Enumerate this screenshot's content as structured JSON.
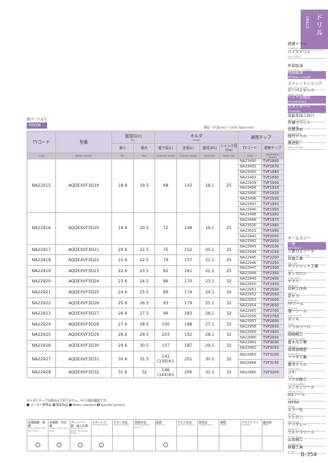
{
  "sidebar": {
    "tab_title": "ドリル",
    "tab_subtitle": "DRILLS",
    "items": [
      {
        "jp": "超硬ドリル",
        "en": "CARBIDE DRILLS",
        "hl": false
      },
      {
        "jp": "ハイスドリル",
        "en": "HSS DRILLS",
        "hl": false
      },
      {
        "jp": "外部給油",
        "en": "EXTERNAL COOLANT",
        "hl": false
      },
      {
        "jp": "内部給油",
        "en": "INTERNAL COOLANT",
        "hl": true
      },
      {
        "jp": "ストレートシャンク",
        "en": "STRAIGHT SHANK",
        "hl": false
      },
      {
        "jp": "テーパシャンク",
        "en": "TAPER SHANK",
        "hl": false
      },
      {
        "jp": "ヘッド交換式",
        "en": "EXCHANGEABLE",
        "hl": true
      },
      {
        "jp": "スタンダード",
        "en": "STANDARD",
        "hl": true
      },
      {
        "jp": "高能率加工向け",
        "en": "HIGH EFFICIENCY",
        "hl": false
      },
      {
        "jp": "先端フラット",
        "en": "FLAT END",
        "hl": false
      },
      {
        "jp": "位置決め",
        "en": "CENTERING",
        "hl": false
      },
      {
        "jp": "段付ドリル",
        "en": "STEP DRILLS",
        "hl": false
      },
      {
        "jp": "周途別",
        "en": "APPLICATION",
        "hl": false
      },
      {
        "jp": "オーエスジー",
        "en": "OSG",
        "hl": false
      },
      {
        "jp": "三菱",
        "en": "MITSUBISHI",
        "hl": true
      },
      {
        "jp": "三菱日立ツール",
        "en": "MMC HITACHI TOOL",
        "hl": false
      },
      {
        "jp": "日進工具",
        "en": "NS TOOL",
        "hl": false
      },
      {
        "jp": "ダイジェット工業",
        "en": "DIJET",
        "hl": false
      },
      {
        "jp": "タンガロイ",
        "en": "TUNGALOY",
        "hl": false
      },
      {
        "jp": "ヤマト",
        "en": "YAMATO",
        "hl": false
      },
      {
        "jp": "日研工作所",
        "en": "NIKKEN",
        "hl": false
      },
      {
        "jp": "京セラ",
        "en": "KYOCERA",
        "hl": false
      },
      {
        "jp": "FPツール",
        "en": "FP TOOL",
        "hl": false
      },
      {
        "jp": "彌一ツール",
        "en": "YAICHI TOOL",
        "hl": false
      },
      {
        "jp": "ダイキ",
        "en": "DAIKI",
        "hl": false
      },
      {
        "jp": "イワタツール",
        "en": "IWATA TOOL",
        "hl": false
      },
      {
        "jp": "岡崎精工",
        "en": "OKAZAKI SEIKO",
        "hl": false
      },
      {
        "jp": "富士元工業",
        "en": "FUJIGEN",
        "hl": false
      },
      {
        "jp": "高周波精密",
        "en": "KOSHUHA",
        "hl": false
      },
      {
        "jp": "イワタ工業",
        "en": "IWATA KOGYO",
        "hl": false
      },
      {
        "jp": "東洋ドリル",
        "en": "TOYO DRILL",
        "hl": false
      },
      {
        "jp": "ユキ",
        "en": "YUKI",
        "hl": false
      },
      {
        "jp": "フクダ精工",
        "en": "FUKUDA SEIKO",
        "hl": false
      },
      {
        "jp": "ユニオンツール",
        "en": "UNION TOOL",
        "hl": false
      },
      {
        "jp": "MAツール",
        "en": "MA TOOL",
        "hl": false
      },
      {
        "jp": "WEBA",
        "en": "WEBA",
        "hl": false
      },
      {
        "jp": "エラー社",
        "en": "ERROR",
        "hl": false
      },
      {
        "jp": "ミシガン",
        "en": "MICHIGAN",
        "hl": false
      },
      {
        "jp": "アリサレー",
        "en": "ARISALEY",
        "hl": false
      },
      {
        "jp": "ウルトラツール",
        "en": "ULTRA TOOL",
        "hl": false
      },
      {
        "jp": "山本精工",
        "en": "YAMAMOTO",
        "hl": false
      },
      {
        "jp": "新報工具",
        "en": "SHINPO",
        "hl": false
      }
    ]
  },
  "header": {
    "page_ref": "前ページより",
    "from_label": "FROM",
    "unit_note": "単位（寸法mm）/ Unit (Size:mm)"
  },
  "table": {
    "h_tycode": "TYコード",
    "h_model": "型番",
    "h_dia": "直径(Dc)",
    "h_dia_en": "Dia.",
    "h_holder": "ホルダ",
    "h_holder_en": "Holder",
    "h_tip": "適用チップ",
    "h_min": "最小",
    "h_max": "最大",
    "h_depth": "首下長(L)",
    "h_overall": "全長(L)",
    "h_neck": "首径(D1)",
    "h_shank": "シャンク径(Ds)",
    "h_tip_tycode": "TYコード",
    "h_tip_model": "適用チップ",
    "e_code": "Code",
    "e_model": "Model number",
    "e_min": "Min",
    "e_max": "Max",
    "e_depth": "Insertion length",
    "e_overall": "Overall Length",
    "e_neck": "Neck Dia.",
    "e_shank": "Shank Dia.",
    "e_tip_code": "Code",
    "e_tip_model": "Application (insert)",
    "groups": [
      {
        "code": "NA22915",
        "model": "AQDEXVF3D19",
        "min": "18.6",
        "max": "19.5",
        "depth": "68",
        "overall": "143",
        "neck": "18.1",
        "shank": "25",
        "tips": [
          [
            "NA23490",
            "TVF1860"
          ],
          [
            "NA23491",
            "TVF1870"
          ],
          [
            "NA23492",
            "TVF1880"
          ],
          [
            "NA23493",
            "TVF1890"
          ],
          [
            "NA22939",
            "TVF1900"
          ],
          [
            "NA23494",
            "TVF1910"
          ],
          [
            "NA23495",
            "TVF1920"
          ],
          [
            "NA23496",
            "TVF1930"
          ],
          [
            "NA23497",
            "TVF1940"
          ],
          [
            "NA22940",
            "TVF1950"
          ]
        ]
      },
      {
        "code": "NA22916",
        "model": "AQDEXVF3D20",
        "min": "19.6",
        "max": "20.5",
        "depth": "72",
        "overall": "148",
        "neck": "19.1",
        "shank": "25",
        "tips": [
          [
            "NA23498",
            "TVF1960"
          ],
          [
            "NA23499",
            "TVF1970"
          ],
          [
            "NA23500",
            "TVF1980"
          ],
          [
            "NA23501",
            "TVF1990"
          ],
          [
            "NA22941",
            "TVF2000"
          ],
          [
            "NA22942",
            "TVF2050"
          ]
        ]
      },
      {
        "code": "NA22917",
        "model": "AQDEXVF3D21",
        "min": "20.6",
        "max": "21.5",
        "depth": "75",
        "overall": "152",
        "neck": "20.1",
        "shank": "25",
        "tips": [
          [
            "NA22943",
            "TVF2100"
          ],
          [
            "NA22944",
            "TVF2150"
          ]
        ]
      },
      {
        "code": "NA22918",
        "model": "AQDEXVF3D22",
        "min": "21.6",
        "max": "22.5",
        "depth": "79",
        "overall": "157",
        "neck": "21.1",
        "shank": "25",
        "tips": [
          [
            "NA22945",
            "TVF2200"
          ],
          [
            "NA22946",
            "TVF2250"
          ]
        ]
      },
      {
        "code": "NA22919",
        "model": "AQDEXVF3D23",
        "min": "22.6",
        "max": "23.5",
        "depth": "82",
        "overall": "161",
        "neck": "22.1",
        "shank": "25",
        "tips": [
          [
            "NA22947",
            "TVF2300"
          ],
          [
            "NA22948",
            "TVF2350"
          ]
        ]
      },
      {
        "code": "NA22920",
        "model": "AQDEXVF3D24",
        "min": "23.6",
        "max": "24.5",
        "depth": "86",
        "overall": "170",
        "neck": "23.1",
        "shank": "32",
        "tips": [
          [
            "NA22949",
            "TVF2400"
          ],
          [
            "NA22950",
            "TVF2450"
          ]
        ]
      },
      {
        "code": "NA22921",
        "model": "AQDEXVF3D25",
        "min": "24.6",
        "max": "25.5",
        "depth": "89",
        "overall": "174",
        "neck": "24.1",
        "shank": "32",
        "tips": [
          [
            "NA22951",
            "TVF2500"
          ],
          [
            "NA22952",
            "TVF2550"
          ]
        ]
      },
      {
        "code": "NA22922",
        "model": "AQDEXVF3D26",
        "min": "25.6",
        "max": "26.5",
        "depth": "93",
        "overall": "179",
        "neck": "25.1",
        "shank": "32",
        "tips": [
          [
            "NA22953",
            "TVF2600"
          ],
          [
            "NA22954",
            "TVF2650"
          ]
        ]
      },
      {
        "code": "NA22923",
        "model": "AQDEXVF3D27",
        "min": "26.6",
        "max": "27.5",
        "depth": "96",
        "overall": "183",
        "neck": "26.1",
        "shank": "32",
        "tips": [
          [
            "NA22955",
            "TVF2700"
          ],
          [
            "NA22956",
            "TVF2750"
          ]
        ]
      },
      {
        "code": "NA22924",
        "model": "AQDEXVF3D28",
        "min": "27.6",
        "max": "28.5",
        "depth": "100",
        "overall": "188",
        "neck": "27.1",
        "shank": "32",
        "tips": [
          [
            "NA22957",
            "TVF2800"
          ],
          [
            "NA22958",
            "TVF2850"
          ]
        ]
      },
      {
        "code": "NA22925",
        "model": "AQDEXVF3D29",
        "min": "28.6",
        "max": "29.5",
        "depth": "103",
        "overall": "192",
        "neck": "28.1",
        "shank": "32",
        "tips": [
          [
            "NA22959",
            "TVF2900"
          ],
          [
            "NA22960",
            "TVF2950"
          ]
        ]
      },
      {
        "code": "NA22926",
        "model": "AQDEXVF3D30",
        "min": "29.6",
        "max": "30.5",
        "depth": "107",
        "overall": "197",
        "neck": "29.1",
        "shank": "32",
        "tips": [
          [
            "NA22961",
            "TVF3000"
          ],
          [
            "NA22962",
            "TVF3050"
          ]
        ]
      },
      {
        "code": "NA22927",
        "model": "AQDEXVF3D31",
        "min": "30.6",
        "max": "31.5",
        "depth": "141\n(139)※1",
        "overall": "201",
        "neck": "30.1",
        "shank": "32",
        "tips": [
          [
            "NA22963",
            "TVF3100"
          ],
          [
            "NA22964",
            "TVF3150"
          ]
        ]
      },
      {
        "code": "NA22928",
        "model": "AQDEXVF3D32",
        "min": "31.6",
        "max": "32",
        "depth": "146\n(144)※1",
        "overall": "206",
        "neck": "31.1",
        "shank": "32",
        "tips": [
          [
            "NA22965",
            "TVF3200"
          ]
        ]
      }
    ]
  },
  "notes": {
    "line1": "ホルダにチップは組込んでありません。※1:()値は裏面です。",
    "legend_std": "メーカー標準品",
    "legend_spec": "限定商品",
    "legend_std_en": "Maker standard",
    "legend_spec_en": "Specific product"
  },
  "materials": {
    "headers": [
      {
        "jp": "炭素鋼鋼・軟鋼",
        "en": "Low Carbon Steel Mild Steel"
      },
      {
        "jp": "炭素鋼・合金鋼",
        "en": "Carbon Steel Alloy Steel"
      },
      {
        "jp": "プレハード鋼・焼入れ鋼",
        "en": "Prehardened Steels Hardened Steels"
      },
      {
        "jp": "ステンレス",
        "en": "Stainless Steels"
      },
      {
        "jp": "チタン合金",
        "en": "Titanium Alloys"
      },
      {
        "jp": "耐熱合金",
        "en": "Heat Resistant Alloys"
      },
      {
        "jp": "鋳鉄",
        "en": "Cast Iron"
      },
      {
        "jp": "アルミ合金",
        "en": "Aluminum Alloys"
      },
      {
        "jp": "銅合金",
        "en": "Copper Alloys"
      },
      {
        "jp": "樹脂",
        "en": "Plastic"
      },
      {
        "jp": "グラファイト",
        "en": "Graphite"
      },
      {
        "jp": "複合材",
        "en": "CFRP"
      }
    ],
    "marks": [
      true,
      true,
      true,
      true,
      false,
      false,
      true,
      false,
      false,
      false,
      false,
      false
    ]
  },
  "page_number": "B-354"
}
